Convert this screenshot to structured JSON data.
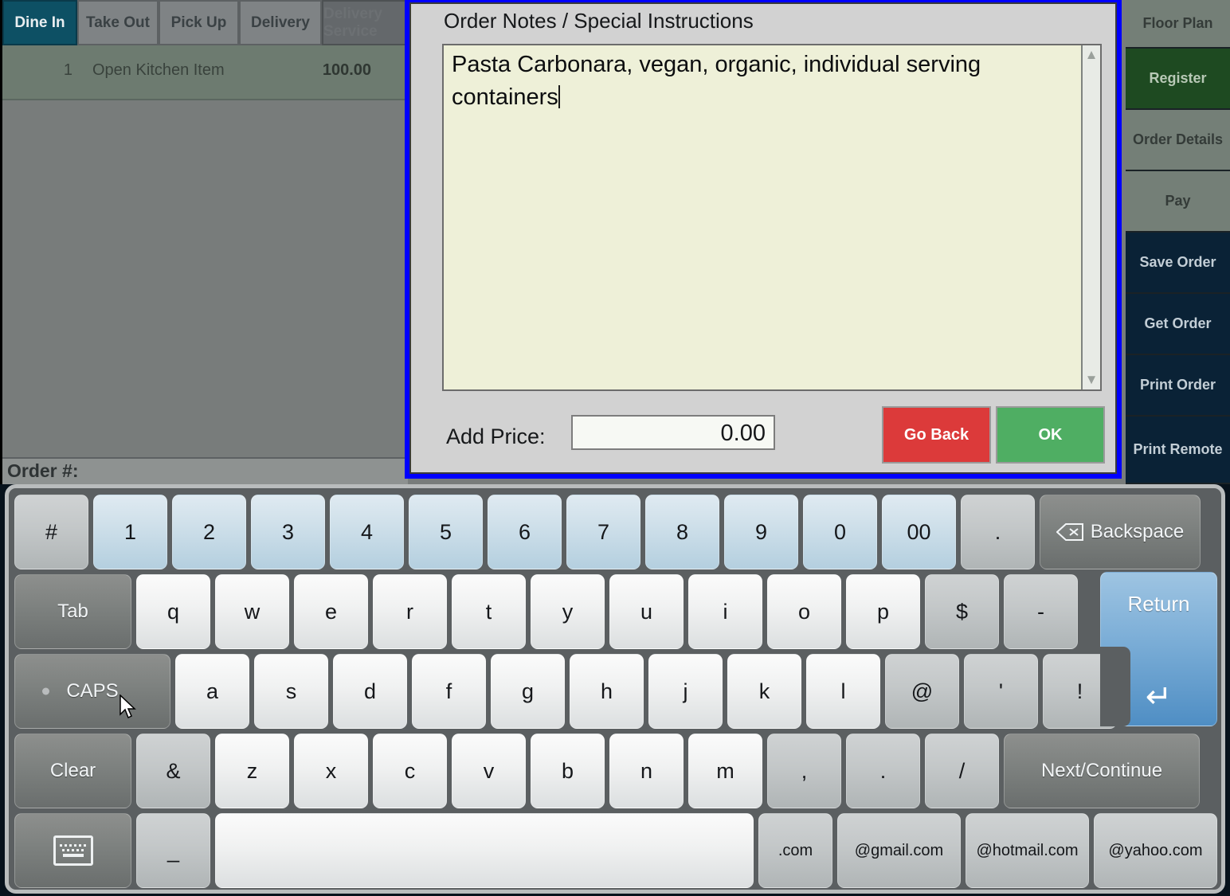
{
  "order_tabs": [
    {
      "label": "Dine In",
      "state": "active"
    },
    {
      "label": "Take Out",
      "state": "normal"
    },
    {
      "label": "Pick Up",
      "state": "normal"
    },
    {
      "label": "Delivery",
      "state": "normal"
    },
    {
      "label": "Delivery Service",
      "state": "disabled"
    }
  ],
  "order": {
    "items": [
      {
        "qty": "1",
        "name": "Open Kitchen Item",
        "price": "100.00"
      }
    ],
    "order_number_label": "Order #:"
  },
  "sidebar": {
    "items": [
      {
        "label": "Floor Plan",
        "style": "grey"
      },
      {
        "label": "Register",
        "style": "green"
      },
      {
        "label": "Order Details",
        "style": "grey"
      },
      {
        "label": "Pay",
        "style": "grey"
      },
      {
        "label": "Save Order",
        "style": "navy"
      },
      {
        "label": "Get Order",
        "style": "navy"
      },
      {
        "label": "Print Order",
        "style": "navy"
      },
      {
        "label": "Print Remote",
        "style": "navy"
      }
    ]
  },
  "dialog": {
    "title": "Order Notes / Special Instructions",
    "notes_value": "Pasta Carbonara, vegan, organic, individual serving containers",
    "price_label": "Add Price:",
    "price_value": "0.00",
    "go_back_label": "Go Back",
    "ok_label": "OK",
    "border_color": "#0000ff"
  },
  "keyboard": {
    "row_num": [
      "#",
      "1",
      "2",
      "3",
      "4",
      "5",
      "6",
      "7",
      "8",
      "9",
      "0",
      "00",
      "."
    ],
    "backspace_label": "Backspace",
    "row_q": [
      "q",
      "w",
      "e",
      "r",
      "t",
      "y",
      "u",
      "i",
      "o",
      "p",
      "$",
      "-"
    ],
    "tab_label": "Tab",
    "return_label": "Return",
    "row_a": [
      "a",
      "s",
      "d",
      "f",
      "g",
      "h",
      "j",
      "k",
      "l",
      "@",
      "'",
      "!"
    ],
    "caps_label": "CAPS",
    "row_z": [
      "&",
      "z",
      "x",
      "c",
      "v",
      "b",
      "n",
      "m",
      ",",
      ".",
      "/"
    ],
    "clear_label": "Clear",
    "next_label": "Next/Continue",
    "underscore_label": "_",
    "space_label": "",
    "email_keys": [
      ".com",
      "@gmail.com",
      "@hotmail.com",
      "@yahoo.com"
    ]
  },
  "colors": {
    "accent_blue": "#0000ff",
    "register_green": "#1e4a21",
    "active_tab_teal": "#0d5064",
    "ok_green": "#4fae63",
    "goback_red": "#dc3a3a",
    "notes_paper": "#eef0d8"
  }
}
